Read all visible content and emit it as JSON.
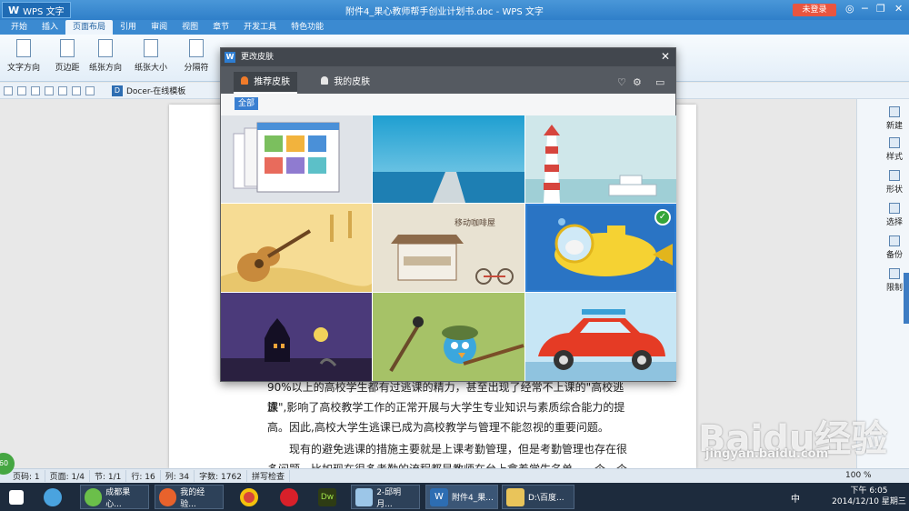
{
  "titlebar": {
    "app_name": "WPS 文字",
    "doc_title": "附件4_果心教师帮手创业计划书.doc - WPS 文字",
    "login_label": "未登录"
  },
  "ribbon_tabs": [
    "开始",
    "插入",
    "页面布局",
    "引用",
    "审阅",
    "视图",
    "章节",
    "开发工具",
    "特色功能"
  ],
  "ribbon_active_tab": "页面布局",
  "ribbon_buttons": [
    "文字方向",
    "页边距",
    "纸张方向",
    "纸张大小",
    "分隔符"
  ],
  "qat": {
    "docer_tab": "Docer-在线模板"
  },
  "skin_dialog": {
    "title": "更改皮肤",
    "tab_recommended": "推荐皮肤",
    "tab_mine": "我的皮肤",
    "filter_all": "全部",
    "skins": [
      {
        "name": "经典"
      },
      {
        "name": "海洋"
      },
      {
        "name": "灯塔"
      },
      {
        "name": "吉他"
      },
      {
        "name": "移动咖啡屋",
        "text": "移动咖啡屋"
      },
      {
        "name": "小黄潜艇",
        "selected": true
      },
      {
        "name": "万圣夜"
      },
      {
        "name": "小鸟士兵"
      },
      {
        "name": "红色汽车"
      }
    ]
  },
  "document": {
    "lines": [
      "90%以上的高校学生都有过逃课的精力，甚至出现了经常不上课的\"高校逃课",
      "族\",影响了高校教学工作的正常开展与大学生专业知识与素质综合能力的提",
      "高。因此,高校大学生逃课已成为高校教学与管理不能忽视的重要问题。",
      "现有的避免逃课的措施主要就是上课考勤管理，但是考勤管理也存在很",
      "多问题，比如现在很多考勤的流程都是教师在台上拿着学生名单，一个一个点"
    ]
  },
  "sidepanel": [
    "新建",
    "样式",
    "形状",
    "选择",
    "备份",
    "限制"
  ],
  "statusbar": {
    "page_code": "页码: 1",
    "page": "页面: 1/4",
    "section": "节: 1/1",
    "row": "行: 16",
    "col": "列: 34",
    "words": "字数: 1762",
    "spellcheck": "拼写检查",
    "zoom": "100 %"
  },
  "taskbar": {
    "items": [
      "成都果心...",
      "我的经验...",
      "2-邱明月...",
      "附件4_果...",
      "D:\\百度..."
    ],
    "lang": "中",
    "time": "下午 6:05",
    "date": "2014/12/10 星期三"
  },
  "watermark": {
    "brand": "Baidu经验",
    "url": "jingyan.baidu.com"
  },
  "green_badge": "60"
}
